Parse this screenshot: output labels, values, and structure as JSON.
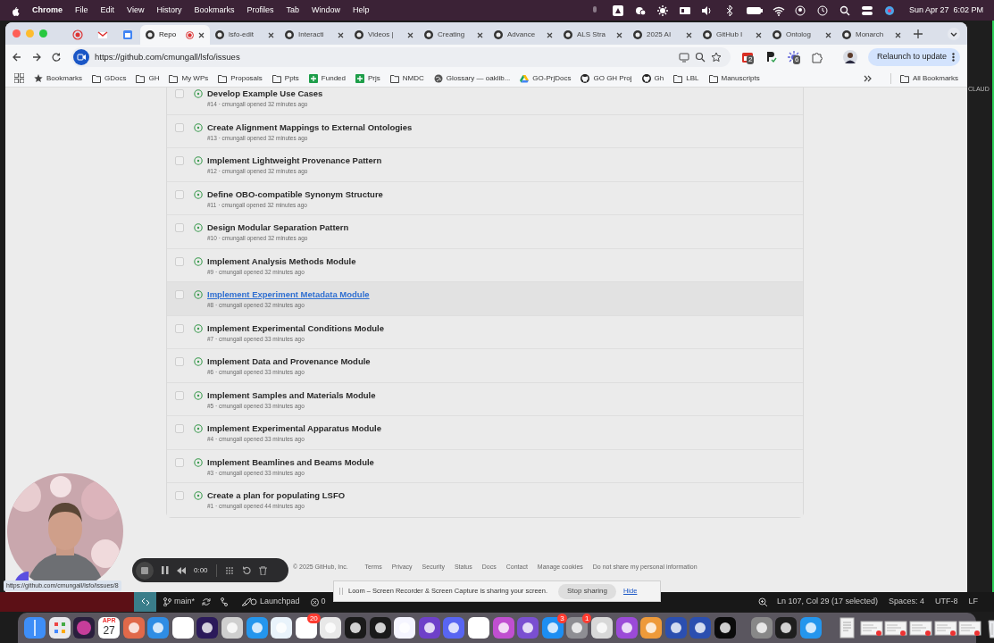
{
  "menu_bar": {
    "app": "Chrome",
    "menus": [
      "File",
      "Edit",
      "View",
      "History",
      "Bookmarks",
      "Profiles",
      "Tab",
      "Window",
      "Help"
    ],
    "clock": "Sun Apr 27  6:02 PM"
  },
  "tabs": [
    {
      "kind": "pinned",
      "selected": false
    },
    {
      "kind": "pinned",
      "selected": false
    },
    {
      "kind": "pinned",
      "selected": false
    },
    {
      "kind": "tab",
      "title": "Repo",
      "selected": true,
      "recording": true
    },
    {
      "kind": "tab",
      "title": "lsfo-edit",
      "selected": false
    },
    {
      "kind": "tab",
      "title": "Interacti",
      "selected": false
    },
    {
      "kind": "tab",
      "title": "Videos |",
      "selected": false
    },
    {
      "kind": "tab",
      "title": "Creating",
      "selected": false
    },
    {
      "kind": "tab",
      "title": "Advance",
      "selected": false
    },
    {
      "kind": "tab",
      "title": "ALS Stra",
      "selected": false
    },
    {
      "kind": "tab",
      "title": "2025 AI",
      "selected": false
    },
    {
      "kind": "tab",
      "title": "GitHub I",
      "selected": false
    },
    {
      "kind": "tab",
      "title": "Ontolog",
      "selected": false
    },
    {
      "kind": "tab",
      "title": "Monarch",
      "selected": false
    }
  ],
  "address_bar": {
    "url": "https://github.com/cmungall/lsfo/issues"
  },
  "extensions": [
    {
      "kind": "calendar",
      "badge": "2"
    },
    {
      "kind": "letter"
    },
    {
      "kind": "burst",
      "badge": "6"
    },
    {
      "kind": "puzzle"
    }
  ],
  "relaunch_button": "Relaunch to update",
  "bookmarks": [
    {
      "kind": "star",
      "label": "Bookmarks"
    },
    {
      "kind": "folder",
      "label": "GDocs"
    },
    {
      "kind": "folder",
      "label": "GH"
    },
    {
      "kind": "folder",
      "label": "My WPs"
    },
    {
      "kind": "folder",
      "label": "Proposals"
    },
    {
      "kind": "folder",
      "label": "Ppts"
    },
    {
      "kind": "sheet",
      "label": "Funded"
    },
    {
      "kind": "sheet",
      "label": "Prjs"
    },
    {
      "kind": "folder",
      "label": "NMDC"
    },
    {
      "kind": "globe",
      "label": "Glossary — oaklib..."
    },
    {
      "kind": "drive",
      "label": "GO-PrjDocs"
    },
    {
      "kind": "github",
      "label": "GO GH Proj"
    },
    {
      "kind": "github",
      "label": "Gh"
    },
    {
      "kind": "folder",
      "label": "LBL"
    },
    {
      "kind": "folder",
      "label": "Manuscripts"
    }
  ],
  "all_bookmarks": "All Bookmarks",
  "issues": [
    {
      "title": "Develop Example Use Cases",
      "meta": "#14 · cmungall opened 32 minutes ago",
      "highlighted": false
    },
    {
      "title": "Create Alignment Mappings to External Ontologies",
      "meta": "#13 · cmungall opened 32 minutes ago",
      "highlighted": false
    },
    {
      "title": "Implement Lightweight Provenance Pattern",
      "meta": "#12 · cmungall opened 32 minutes ago",
      "highlighted": false
    },
    {
      "title": "Define OBO-compatible Synonym Structure",
      "meta": "#11 · cmungall opened 32 minutes ago",
      "highlighted": false
    },
    {
      "title": "Design Modular Separation Pattern",
      "meta": "#10 · cmungall opened 32 minutes ago",
      "highlighted": false
    },
    {
      "title": "Implement Analysis Methods Module",
      "meta": "#9 · cmungall opened 32 minutes ago",
      "highlighted": false
    },
    {
      "title": "Implement Experiment Metadata Module",
      "meta": "#8 · cmungall opened 32 minutes ago",
      "highlighted": true
    },
    {
      "title": "Implement Experimental Conditions Module",
      "meta": "#7 · cmungall opened 33 minutes ago",
      "highlighted": false
    },
    {
      "title": "Implement Data and Provenance Module",
      "meta": "#6 · cmungall opened 33 minutes ago",
      "highlighted": false
    },
    {
      "title": "Implement Samples and Materials Module",
      "meta": "#5 · cmungall opened 33 minutes ago",
      "highlighted": false
    },
    {
      "title": "Implement Experimental Apparatus Module",
      "meta": "#4 · cmungall opened 33 minutes ago",
      "highlighted": false
    },
    {
      "title": "Implement Beamlines and Beams Module",
      "meta": "#3 · cmungall opened 33 minutes ago",
      "highlighted": false
    },
    {
      "title": "Create a plan for populating LSFO",
      "meta": "#1 · cmungall opened 44 minutes ago",
      "highlighted": false
    }
  ],
  "footer": {
    "copyright": "© 2025 GitHub, Inc.",
    "links": [
      "Terms",
      "Privacy",
      "Security",
      "Status",
      "Docs",
      "Contact",
      "Manage cookies",
      "Do not share my personal information"
    ]
  },
  "status_url": "https://github.com/cmungall/lsfo/issues/8",
  "loom_controls": {
    "timer": "0:00"
  },
  "loom_banner": {
    "message": "Loom – Screen Recorder & Screen Capture is sharing your screen.",
    "stop_button": "Stop sharing",
    "hide_link": "Hide"
  },
  "side_window": {
    "text": "CLAUD"
  },
  "editor_status_bar": {
    "branch": "main*",
    "launchpad": "Launchpad",
    "errors": "0",
    "cursor": "Ln 107, Col 29 (17 selected)",
    "indent": "Spaces: 4",
    "encoding": "UTF-8",
    "eol": "LF"
  },
  "dock": [
    {
      "kind": "app"
    },
    {
      "kind": "app"
    },
    {
      "kind": "app"
    },
    {
      "kind": "calendar",
      "month": "APR",
      "day": "27"
    },
    {
      "kind": "app"
    },
    {
      "kind": "app"
    },
    {
      "kind": "app"
    },
    {
      "kind": "app"
    },
    {
      "kind": "app"
    },
    {
      "kind": "app"
    },
    {
      "kind": "app"
    },
    {
      "kind": "app",
      "badge": "20"
    },
    {
      "kind": "app"
    },
    {
      "kind": "app"
    },
    {
      "kind": "app"
    },
    {
      "kind": "app"
    },
    {
      "kind": "app"
    },
    {
      "kind": "app"
    },
    {
      "kind": "app"
    },
    {
      "kind": "app"
    },
    {
      "kind": "app"
    },
    {
      "kind": "app",
      "badge": "3"
    },
    {
      "kind": "app",
      "badge": "1"
    },
    {
      "kind": "app"
    },
    {
      "kind": "app"
    },
    {
      "kind": "app"
    },
    {
      "kind": "app"
    },
    {
      "kind": "app"
    },
    {
      "kind": "app"
    },
    {
      "kind": "divider"
    },
    {
      "kind": "app"
    },
    {
      "kind": "app"
    },
    {
      "kind": "app"
    },
    {
      "kind": "divider"
    },
    {
      "kind": "document"
    },
    {
      "kind": "window"
    },
    {
      "kind": "window"
    },
    {
      "kind": "window"
    },
    {
      "kind": "window"
    },
    {
      "kind": "window"
    },
    {
      "kind": "trash"
    }
  ]
}
